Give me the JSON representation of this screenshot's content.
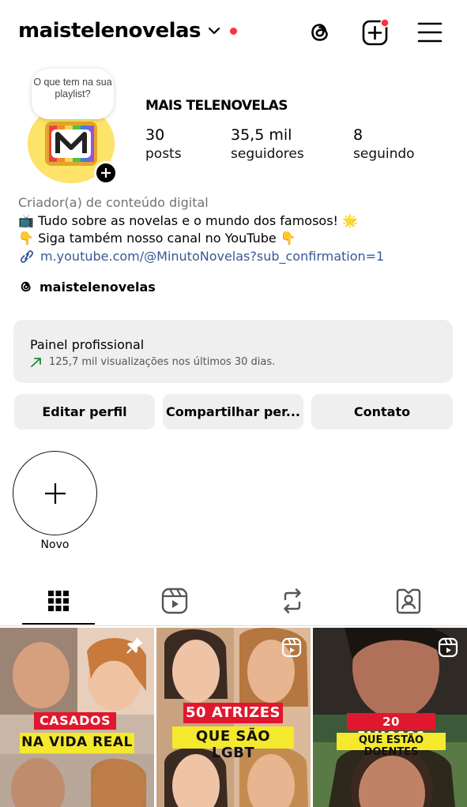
{
  "header": {
    "username": "maistelenovelas",
    "icons": [
      "chevron-down-icon",
      "threads-icon",
      "create-post-icon",
      "menu-icon"
    ],
    "notification_color": "#ff3040"
  },
  "profile": {
    "display_name": "MAIS TELENOVELAS",
    "note": "O que tem na sua playlist?",
    "stats": {
      "posts": {
        "value": "30",
        "label": "posts"
      },
      "followers": {
        "value": "35,5 mil",
        "label": "seguidores"
      },
      "following": {
        "value": "8",
        "label": "seguindo"
      }
    },
    "category": "Criador(a) de conteúdo digital",
    "bio_line1": "Tudo sobre as novelas e o mundo dos famosos!",
    "bio_line2": "Siga também nosso canal no YouTube",
    "link": "m.youtube.com/@MinutoNovelas?sub_confirmation=1",
    "threads_handle": "maistelenovelas",
    "link_color": "#385898"
  },
  "dashboard": {
    "title": "Painel profissional",
    "subtitle": "125,7 mil visualizações nos últimos 30 dias."
  },
  "buttons": {
    "edit": "Editar perfil",
    "share": "Compartilhar per...",
    "contact": "Contato"
  },
  "highlights": {
    "new_label": "Novo"
  },
  "tabs": [
    "grid-icon",
    "reels-icon",
    "reposts-icon",
    "tagged-icon"
  ],
  "grid": [
    {
      "caption_top": "CASADOS",
      "caption_bottom": "NA VIDA REAL",
      "badge": "pin-icon"
    },
    {
      "caption_top": "50 ATRIZES",
      "caption_bottom": "QUE SÃO LGBT",
      "badge": "reel-icon"
    },
    {
      "caption_top": "20 FAMOSOS",
      "caption_bottom": "QUE ESTÃO DOENTES",
      "badge": "reel-icon"
    }
  ]
}
